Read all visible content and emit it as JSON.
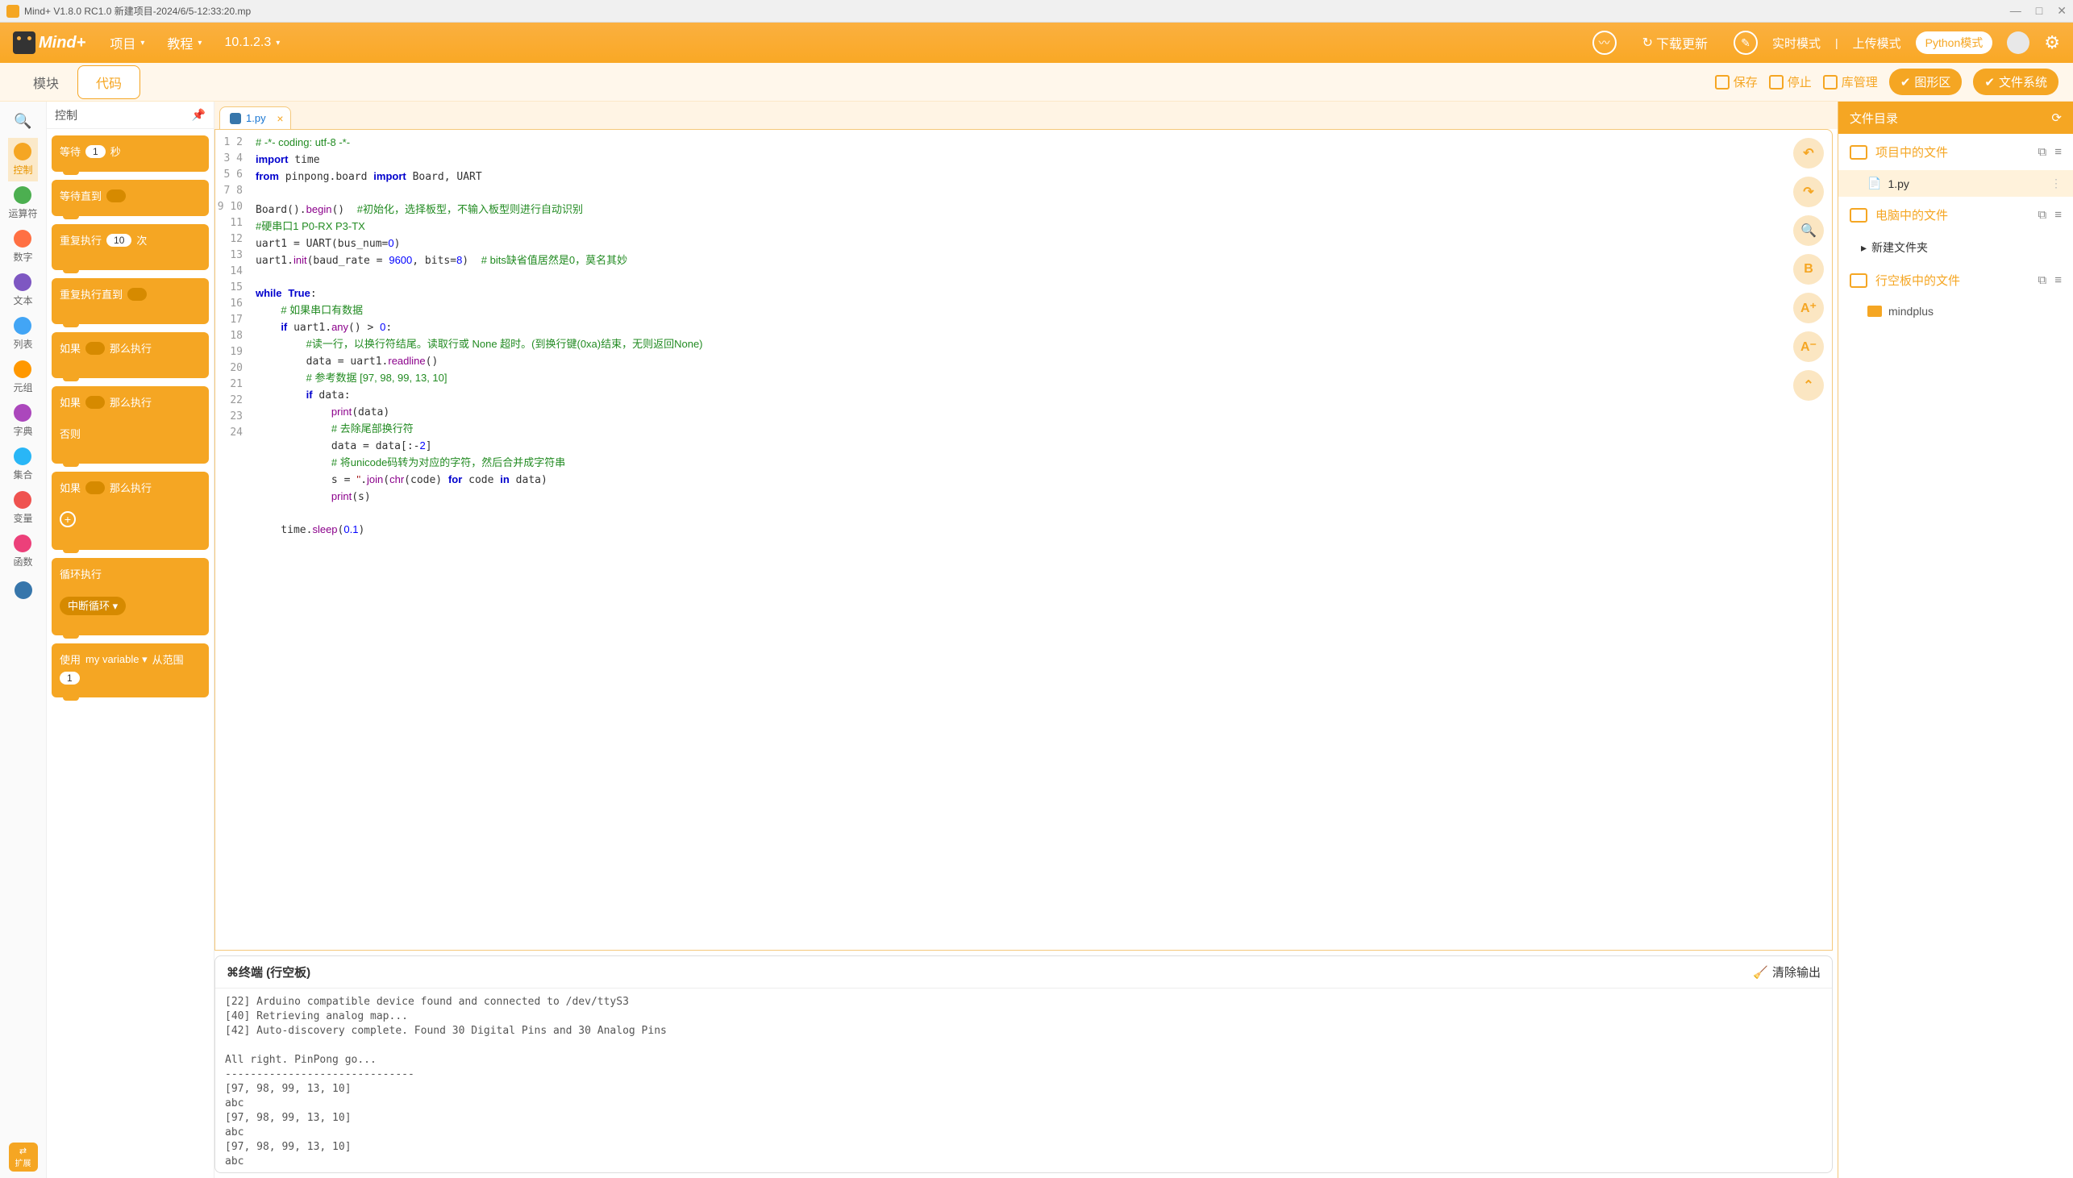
{
  "titlebar": {
    "text": "Mind+ V1.8.0 RC1.0   新建项目-2024/6/5-12:33:20.mp"
  },
  "topbar": {
    "logo": "Mind+",
    "menu_project": "项目",
    "menu_tutorial": "教程",
    "menu_ip": "10.1.2.3",
    "download_update": "下载更新",
    "mode_realtime": "实时模式",
    "mode_upload": "上传模式",
    "mode_python": "Python模式"
  },
  "toolbar": {
    "tab_blocks": "模块",
    "tab_code": "代码",
    "save": "保存",
    "stop": "停止",
    "lib": "库管理",
    "graph": "图形区",
    "files": "文件系统"
  },
  "rail": {
    "search": "",
    "items": [
      {
        "label": "控制",
        "color": "#f5a623"
      },
      {
        "label": "运算符",
        "color": "#4caf50"
      },
      {
        "label": "数字",
        "color": "#ff7043"
      },
      {
        "label": "文本",
        "color": "#7e57c2"
      },
      {
        "label": "列表",
        "color": "#42a5f5"
      },
      {
        "label": "元组",
        "color": "#ff9800"
      },
      {
        "label": "字典",
        "color": "#ab47bc"
      },
      {
        "label": "集合",
        "color": "#29b6f6"
      },
      {
        "label": "变量",
        "color": "#ef5350"
      },
      {
        "label": "函数",
        "color": "#ec407a"
      }
    ],
    "python": "",
    "extend": "扩展"
  },
  "block_panel": {
    "title": "控制",
    "blocks": [
      {
        "parts": [
          "等待",
          {
            "pill": "1"
          },
          "秒"
        ]
      },
      {
        "parts": [
          "等待直到",
          {
            "slot": true
          }
        ]
      },
      {
        "parts": [
          "重复执行",
          {
            "pill": "10"
          },
          "次"
        ],
        "c": true
      },
      {
        "parts": [
          "重复执行直到",
          {
            "slot": true
          }
        ],
        "c": true
      },
      {
        "parts": [
          "如果",
          {
            "slot": true
          },
          "那么执行"
        ],
        "c": true
      },
      {
        "parts": [
          "如果",
          {
            "slot": true
          },
          "那么执行"
        ],
        "else": "否则",
        "c": true
      },
      {
        "parts": [
          "如果",
          {
            "slot": true
          },
          "那么执行"
        ],
        "plus": true,
        "c": true
      },
      {
        "parts": [
          "循环执行"
        ],
        "c": true,
        "inner": "中断循环 ▾"
      },
      {
        "parts": [
          "使用",
          "my variable ▾",
          "从范围",
          {
            "pill": "1"
          }
        ]
      }
    ]
  },
  "editor": {
    "tab_name": "1.py",
    "lines": [
      {
        "n": 1,
        "html": "<span class='cm'># -*- coding: utf-8 -*-</span>"
      },
      {
        "n": 2,
        "html": "<span class='kw'>import</span> time"
      },
      {
        "n": 3,
        "html": "<span class='kw'>from</span> pinpong.board <span class='kw'>import</span> Board, UART"
      },
      {
        "n": 4,
        "html": ""
      },
      {
        "n": 5,
        "html": "Board().<span class='fn'>begin</span>()  <span class='cm'>#初始化，选择板型，不输入板型则进行自动识别</span>"
      },
      {
        "n": 6,
        "html": "<span class='cm'>#硬串口1 P0-RX P3-TX</span>"
      },
      {
        "n": 7,
        "html": "uart1 = UART(bus_num=<span class='num'>0</span>)"
      },
      {
        "n": 8,
        "html": "uart1.<span class='fn'>init</span>(baud_rate = <span class='num'>9600</span>, bits=<span class='num'>8</span>)  <span class='cm'># bits缺省值居然是0，莫名其妙</span>"
      },
      {
        "n": 9,
        "html": ""
      },
      {
        "n": 10,
        "html": "<span class='kw'>while</span> <span class='kw'>True</span>:"
      },
      {
        "n": 11,
        "html": "    <span class='cm'># 如果串口有数据</span>"
      },
      {
        "n": 12,
        "html": "    <span class='kw'>if</span> uart1.<span class='fn'>any</span>() &gt; <span class='num'>0</span>:"
      },
      {
        "n": 13,
        "html": "        <span class='cm'>#读一行，以换行符结尾。读取行或 None 超时。(到换行键(0xa)结束，无则返回None)</span>"
      },
      {
        "n": 14,
        "html": "        data = uart1.<span class='fn'>readline</span>()"
      },
      {
        "n": 15,
        "html": "        <span class='cm'># 参考数据 [97, 98, 99, 13, 10]</span>"
      },
      {
        "n": 16,
        "html": "        <span class='kw'>if</span> data:"
      },
      {
        "n": 17,
        "html": "            <span class='fn'>print</span>(data)"
      },
      {
        "n": 18,
        "html": "            <span class='cm'># 去除尾部换行符</span>"
      },
      {
        "n": 19,
        "html": "            data = data[:-<span class='num'>2</span>]"
      },
      {
        "n": 20,
        "html": "            <span class='cm'># 将unicode码转为对应的字符，然后合并成字符串</span>"
      },
      {
        "n": 21,
        "html": "            s = <span class='str'>''</span>.<span class='fn'>join</span>(<span class='fn'>chr</span>(code) <span class='kw'>for</span> code <span class='kw'>in</span> data)"
      },
      {
        "n": 22,
        "html": "            <span class='fn'>print</span>(s)"
      },
      {
        "n": 23,
        "html": ""
      },
      {
        "n": 24,
        "html": "    time.<span class='fn'>sleep</span>(<span class='num'>0.1</span>)"
      }
    ],
    "side_tools": [
      "↶",
      "↷",
      "🔍",
      "B",
      "A⁺",
      "A⁻",
      "⌃"
    ]
  },
  "terminal": {
    "title": "终端 (行空板)",
    "clear": "清除输出",
    "output": "[22] Arduino compatible device found and connected to /dev/ttyS3\n[40] Retrieving analog map...\n[42] Auto-discovery complete. Found 30 Digital Pins and 30 Analog Pins\n\nAll right. PinPong go...\n------------------------------\n[97, 98, 99, 13, 10]\nabc\n[97, 98, 99, 13, 10]\nabc\n[97, 98, 99, 13, 10]\nabc\n—"
  },
  "file_panel": {
    "title": "文件目录",
    "sec_project": "项目中的文件",
    "file1": "1.py",
    "sec_computer": "电脑中的文件",
    "sub_newfolder": "新建文件夹",
    "sec_board": "行空板中的文件",
    "folder": "mindplus"
  }
}
